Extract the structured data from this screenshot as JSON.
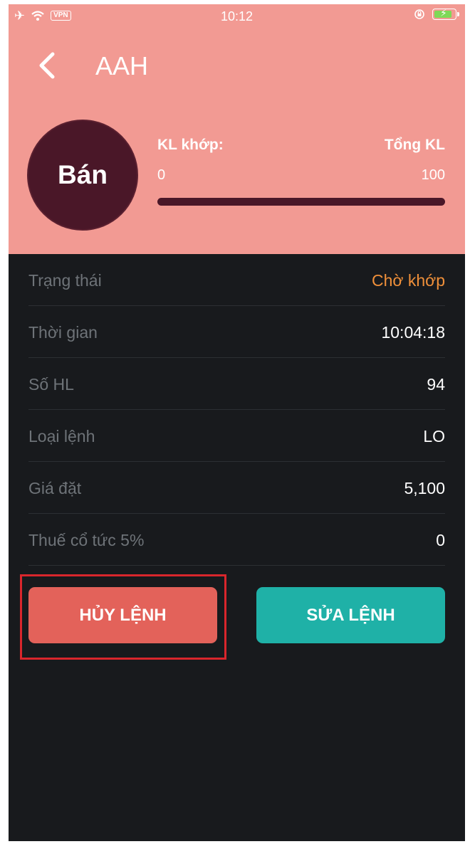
{
  "status_bar": {
    "time": "10:12",
    "vpn": "VPN"
  },
  "header": {
    "title": "AAH",
    "side_label": "Bán",
    "matched_label": "KL khớp:",
    "total_label": "Tổng KL",
    "matched_value": "0",
    "total_value": "100",
    "progress_fraction": 0.0
  },
  "details": [
    {
      "label": "Trạng thái",
      "value": "Chờ khớp"
    },
    {
      "label": "Thời gian",
      "value": "10:04:18"
    },
    {
      "label": "Số HL",
      "value": "94"
    },
    {
      "label": "Loại lệnh",
      "value": "LO"
    },
    {
      "label": "Giá đặt",
      "value": "5,100"
    },
    {
      "label": "Thuế cổ tức 5%",
      "value": "0"
    }
  ],
  "actions": {
    "cancel_label": "HỦY LỆNH",
    "edit_label": "SỬA LỆNH"
  },
  "colors": {
    "header_bg": "#f29a93",
    "side_circle": "#4a1728",
    "status_pending": "#f0903a",
    "cancel_button": "#e3625a",
    "edit_button": "#1fb1a7",
    "highlight_box": "#d9262c"
  }
}
